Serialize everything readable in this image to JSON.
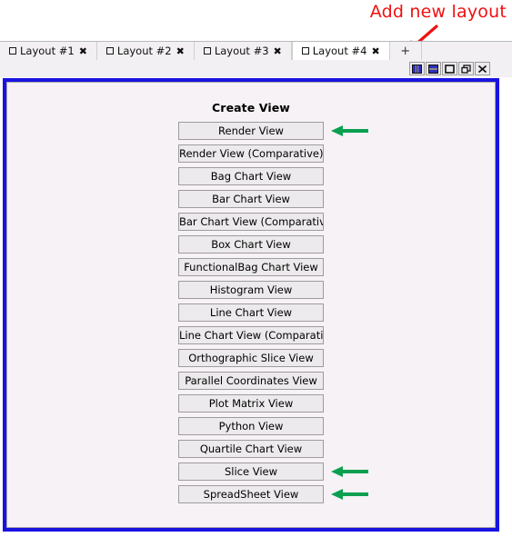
{
  "annotation": {
    "label": "Add new layout",
    "color": "#ee1111",
    "arrow_name": "red-arrow-to-add-tab"
  },
  "tabstrip": {
    "tabs": [
      {
        "label": "Layout #1",
        "checkbox_icon": "square-icon",
        "close_icon": "close-icon",
        "active": false
      },
      {
        "label": "Layout #2",
        "checkbox_icon": "square-icon",
        "close_icon": "close-icon",
        "active": false
      },
      {
        "label": "Layout #3",
        "checkbox_icon": "square-icon",
        "close_icon": "close-icon",
        "active": false
      },
      {
        "label": "Layout #4",
        "checkbox_icon": "square-icon",
        "close_icon": "close-icon",
        "active": true
      }
    ],
    "add_tab_label": "+"
  },
  "view_toolbar": {
    "buttons": [
      {
        "name": "split-vertical-icon",
        "title": "Split Horizontal"
      },
      {
        "name": "split-horizontal-icon",
        "title": "Split Vertical"
      },
      {
        "name": "maximize-icon",
        "title": "Maximize"
      },
      {
        "name": "restore-icon",
        "title": "Restore"
      },
      {
        "name": "close-view-icon",
        "title": "Close"
      }
    ]
  },
  "view_panel": {
    "border_color": "#1a13e0",
    "background_color": "#f7f2f5",
    "title": "Create View",
    "highlight_arrow_color": "#0aa050",
    "buttons": [
      {
        "label": "Render View",
        "highlighted": true
      },
      {
        "label": "Render View (Comparative)",
        "highlighted": false
      },
      {
        "label": "Bag Chart View",
        "highlighted": false
      },
      {
        "label": "Bar Chart View",
        "highlighted": false
      },
      {
        "label": "Bar Chart View (Comparative)",
        "highlighted": false
      },
      {
        "label": "Box Chart View",
        "highlighted": false
      },
      {
        "label": "FunctionalBag Chart View",
        "highlighted": false
      },
      {
        "label": "Histogram View",
        "highlighted": false
      },
      {
        "label": "Line Chart View",
        "highlighted": false
      },
      {
        "label": "Line Chart View (Comparative)",
        "highlighted": false
      },
      {
        "label": "Orthographic Slice View",
        "highlighted": false
      },
      {
        "label": "Parallel Coordinates View",
        "highlighted": false
      },
      {
        "label": "Plot Matrix View",
        "highlighted": false
      },
      {
        "label": "Python View",
        "highlighted": false
      },
      {
        "label": "Quartile Chart View",
        "highlighted": false
      },
      {
        "label": "Slice View",
        "highlighted": true
      },
      {
        "label": "SpreadSheet View",
        "highlighted": true
      }
    ]
  }
}
